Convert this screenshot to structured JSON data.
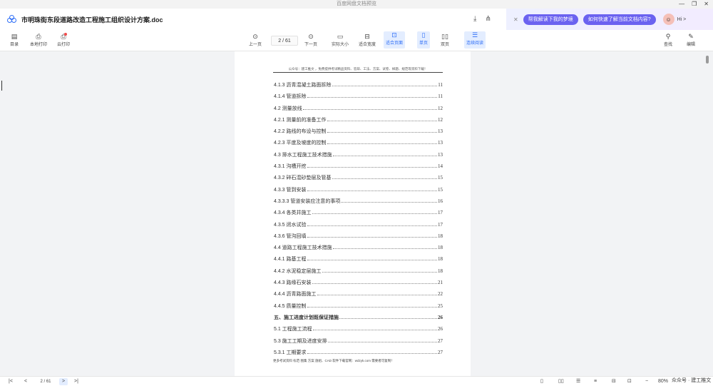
{
  "os": {
    "title": "百度网盘文档预览",
    "controls": [
      "—",
      "❐",
      "✕"
    ]
  },
  "titlebar": {
    "doc_title": "市明珠街东段道路改造工程施工组织设计方案.doc",
    "ai": {
      "chips": [
        "帮我解读下我的梦境",
        "如何快速了解当前文档内容?"
      ],
      "hi": "Hi >"
    }
  },
  "toolbar": {
    "left": [
      {
        "label": "目录",
        "icon": "toc-icon"
      },
      {
        "label": "本地打印",
        "icon": "printer-icon"
      },
      {
        "label": "云打印",
        "icon": "cloud-print-icon"
      }
    ],
    "prev_label": "上一页",
    "page_indicator": "2 / 61",
    "next_label": "下一页",
    "view": [
      {
        "label": "实际大小"
      },
      {
        "label": "适合宽度"
      },
      {
        "label": "适合页面"
      },
      {
        "label": "单页"
      },
      {
        "label": "双页"
      },
      {
        "label": "连续阅读"
      }
    ],
    "right": [
      {
        "label": "查找"
      },
      {
        "label": "编辑"
      }
    ]
  },
  "page": {
    "header": "公众号：建工推文 ，免费提供考试精品资料、答辩、工法、方案、试卷、样题、规范等资料下载！",
    "toc": [
      {
        "title": "4.1.3 沥青混凝土路面拆除",
        "page": "11"
      },
      {
        "title": "4.1.4 管道拆除",
        "page": "11"
      },
      {
        "title": "4.2 测量放线",
        "page": "12"
      },
      {
        "title": "4.2.1 测量前的准备工作",
        "page": "12"
      },
      {
        "title": "4.2.2 路线的布设与控制",
        "page": "13"
      },
      {
        "title": "4.2.3 平度及坡度的控制",
        "page": "13"
      },
      {
        "title": "4.3 排水工程施工技术措施",
        "page": "13"
      },
      {
        "title": "4.3.1 沟槽开挖",
        "page": "14"
      },
      {
        "title": "4.3.2 碎石混砂垫层及管基",
        "page": "15"
      },
      {
        "title": "4.3.3 管到安装",
        "page": "15"
      },
      {
        "title": "4.3.3.3 管道安装应注意的事项",
        "page": "16"
      },
      {
        "title": "4.3.4 各类井施工",
        "page": "17"
      },
      {
        "title": "4.3.5 闭水试验",
        "page": "17"
      },
      {
        "title": "4.3.6 管沟回填",
        "page": "18"
      },
      {
        "title": "4.4 道路工程施工技术措施",
        "page": "18"
      },
      {
        "title": "4.4.1 路基工程",
        "page": "18"
      },
      {
        "title": "4.4.2 水泥稳定层施工",
        "page": "18"
      },
      {
        "title": "4.4.3 路缘石安装",
        "page": "21"
      },
      {
        "title": "4.4.4 沥青路面施工",
        "page": "22"
      },
      {
        "title": "4.4.5 质量控制",
        "page": "25"
      },
      {
        "title": "五、施工进度计划既保证措施",
        "page": "26"
      },
      {
        "title": "5.1 工程施工流程",
        "page": "26"
      },
      {
        "title": "5.3 施工工期及进度安排",
        "page": "27"
      },
      {
        "title": "5.3.1 工期要求",
        "page": "27"
      }
    ],
    "footer": "更多考试资料 标范 图集 方案 施组、CAD 软件下载官网：wdzyk.com 需要者可复制！"
  },
  "bottombar": {
    "page_indicator": "2 / 61",
    "zoom": "80%"
  },
  "watermark": "众众号 · 建工推文"
}
